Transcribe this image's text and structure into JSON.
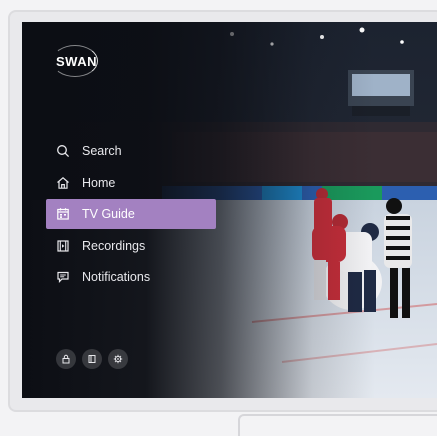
{
  "brand": {
    "name": "SWAN"
  },
  "menu": {
    "items": [
      {
        "label": "Search",
        "icon": "search-icon"
      },
      {
        "label": "Home",
        "icon": "home-icon"
      },
      {
        "label": "TV Guide",
        "icon": "calendar-icon",
        "active": true
      },
      {
        "label": "Recordings",
        "icon": "film-icon"
      },
      {
        "label": "Notifications",
        "icon": "message-icon"
      }
    ]
  },
  "footer_icons": [
    "lock-icon",
    "book-icon",
    "gear-icon"
  ],
  "colors": {
    "accent": "#a381c1",
    "background": "#0e1118",
    "text": "#e8e8ec"
  }
}
